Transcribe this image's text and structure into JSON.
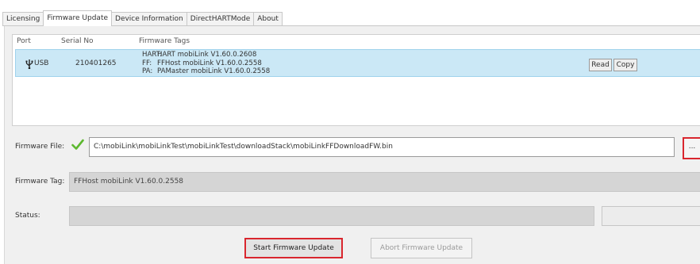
{
  "tabs": [
    {
      "label": "Licensing"
    },
    {
      "label": "Firmware Update"
    },
    {
      "label": "Device Information"
    },
    {
      "label": "DirectHARTMode"
    },
    {
      "label": "About"
    }
  ],
  "device_grid": {
    "headers": {
      "port": "Port",
      "serial": "Serial No",
      "tags": "Firmware Tags"
    },
    "row": {
      "port": "USB",
      "serial": "210401265",
      "tags": [
        {
          "key": "HART:",
          "value": "HART mobiLink V1.60.0.2608"
        },
        {
          "key": "FF:",
          "value": "FFHost mobiLink V1.60.0.2558"
        },
        {
          "key": "PA:",
          "value": "PAMaster mobiLink V1.60.0.2558"
        }
      ],
      "read_label": "Read",
      "copy_label": "Copy"
    }
  },
  "firmware_file": {
    "label": "Firmware File:",
    "value": "C:\\mobiLink\\mobiLinkTest\\mobiLinkTest\\downloadStack\\mobiLinkFFDownloadFW.bin",
    "browse_label": "..."
  },
  "firmware_tag": {
    "label": "Firmware Tag:",
    "value": "FFHost mobiLink V1.60.0.2558"
  },
  "status": {
    "label": "Status:",
    "progress": 0,
    "text": ""
  },
  "buttons": {
    "start": "Start Firmware Update",
    "abort": "Abort Firmware Update"
  },
  "colors": {
    "highlight_red": "#d9262e",
    "selected_row": "#cbe8f6",
    "check_green": "#5cb82e"
  },
  "icons": {
    "port": "usb-icon",
    "file_status": "check-icon"
  }
}
